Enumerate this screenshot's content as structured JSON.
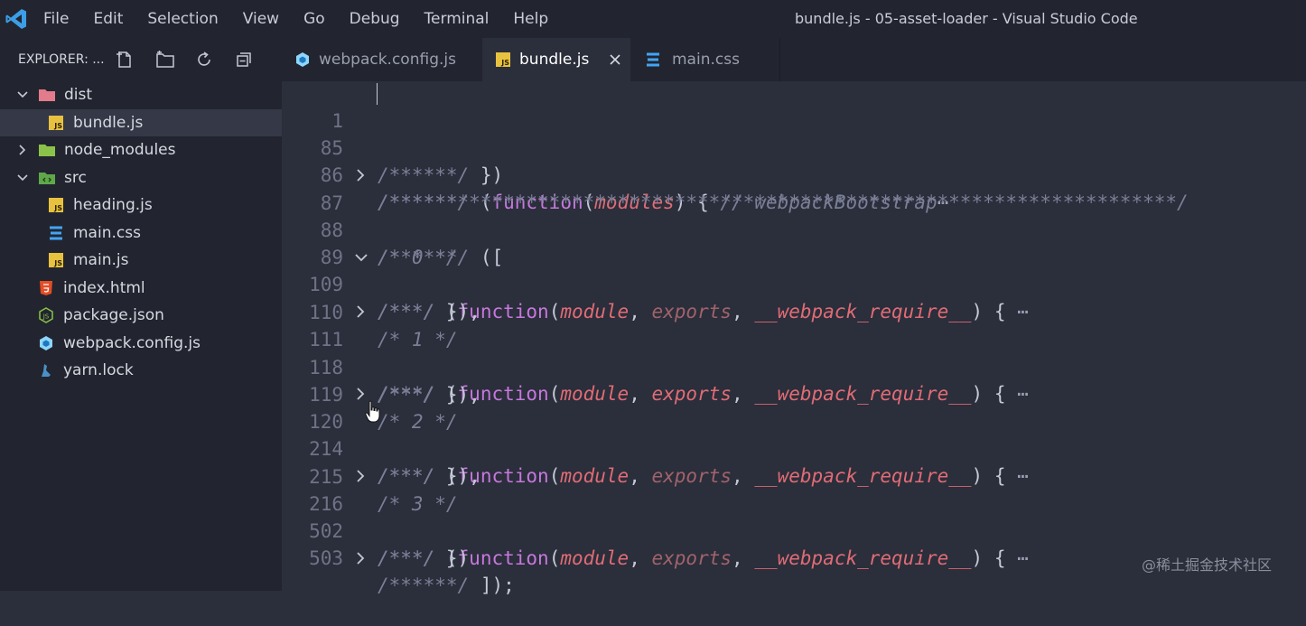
{
  "menu": [
    "File",
    "Edit",
    "Selection",
    "View",
    "Go",
    "Debug",
    "Terminal",
    "Help"
  ],
  "window_title": "bundle.js - 05-asset-loader - Visual Studio Code",
  "explorer": {
    "title": "EXPLORER: ...",
    "actions": [
      "new-file-icon",
      "new-folder-icon",
      "refresh-icon",
      "collapse-all-icon"
    ],
    "tree": [
      {
        "label": "dist",
        "type": "folder",
        "open": true
      },
      {
        "label": "bundle.js",
        "type": "js",
        "selected": true
      },
      {
        "label": "node_modules",
        "type": "folder",
        "open": false
      },
      {
        "label": "src",
        "type": "folder",
        "open": true
      },
      {
        "label": "heading.js",
        "type": "js"
      },
      {
        "label": "main.css",
        "type": "css"
      },
      {
        "label": "main.js",
        "type": "js"
      },
      {
        "label": "index.html",
        "type": "html"
      },
      {
        "label": "package.json",
        "type": "json"
      },
      {
        "label": "webpack.config.js",
        "type": "webpack"
      },
      {
        "label": "yarn.lock",
        "type": "yarn"
      }
    ]
  },
  "tabs": [
    {
      "label": "webpack.config.js",
      "icon": "webpack-icon",
      "active": false
    },
    {
      "label": "bundle.js",
      "icon": "js-file-icon",
      "active": true
    },
    {
      "label": "main.css",
      "icon": "css-file-icon",
      "active": false
    }
  ],
  "editor": {
    "line_numbers": [
      "1",
      "85",
      "86",
      "87",
      "88",
      "89",
      "109",
      "110",
      "111",
      "118",
      "119",
      "120",
      "214",
      "215",
      "216",
      "502",
      "503"
    ],
    "strings": {
      "c6": "/******/",
      "c3": "/***/",
      "stars": "/*********************************************************************/",
      "bootstrap": "// webpackBootstrap",
      "open_paren": "(",
      "function": "function",
      "modules": "modules",
      "module": "module",
      "exports": "exports",
      "require": "__webpack_require__",
      "close_brace_paren": "})",
      "close_brace_paren_comma": "}),",
      "open_bracket": "([",
      "end": "]);",
      "m0": "/* 0 */",
      "m1": "/* 1 */",
      "m2": "/* 2 */",
      "m3": "/* 3 */",
      "ellipsis": "⋯"
    }
  },
  "watermark": "@稀土掘金技术社区",
  "colors": {
    "accent_blue": "#3c9ee8",
    "keyword": "#c678dd",
    "param": "#e06c75",
    "comment": "#7a7f96",
    "js_yellow": "#e8c140"
  }
}
